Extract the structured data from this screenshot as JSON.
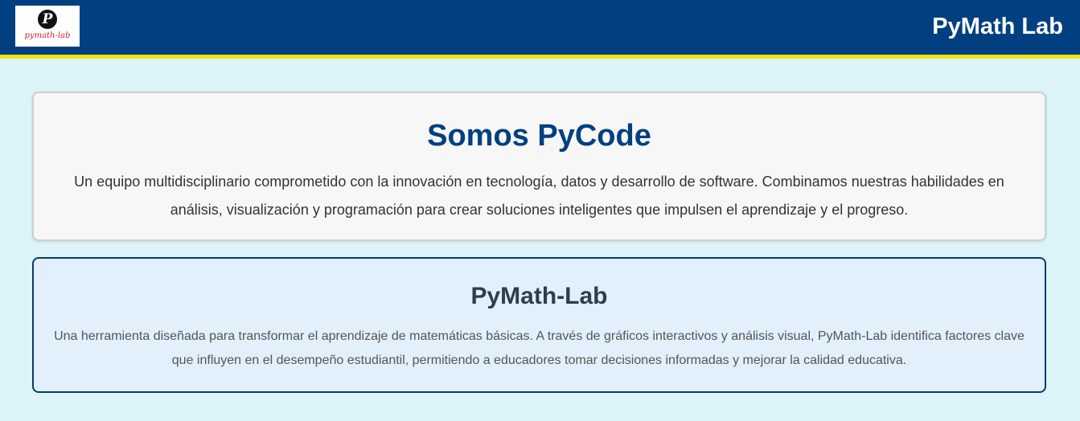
{
  "header": {
    "logo": {
      "icon": "p-monogram-icon",
      "mark": "P",
      "text": "pymath-lab"
    },
    "title": "PyMath Lab"
  },
  "about": {
    "title": "Somos PyCode",
    "text": "Un equipo multidisciplinario comprometido con la innovación en tecnología, datos y desarrollo de software. Combinamos nuestras habilidades en análisis, visualización y programación para crear soluciones inteligentes que impulsen el aprendizaje y el progreso."
  },
  "product": {
    "title": "PyMath-Lab",
    "text": "Una herramienta diseñada para transformar el aprendizaje de matemáticas básicas. A través de gráficos interactivos y análisis visual, PyMath-Lab identifica factores clave que influyen en el desempeño estudiantil, permitiendo a educadores tomar decisiones informadas y mejorar la calidad educativa."
  },
  "colors": {
    "header_bg": "#004080",
    "header_accent": "#f2e30f",
    "page_bg": "#dcf4f8",
    "title_blue": "#004080"
  }
}
